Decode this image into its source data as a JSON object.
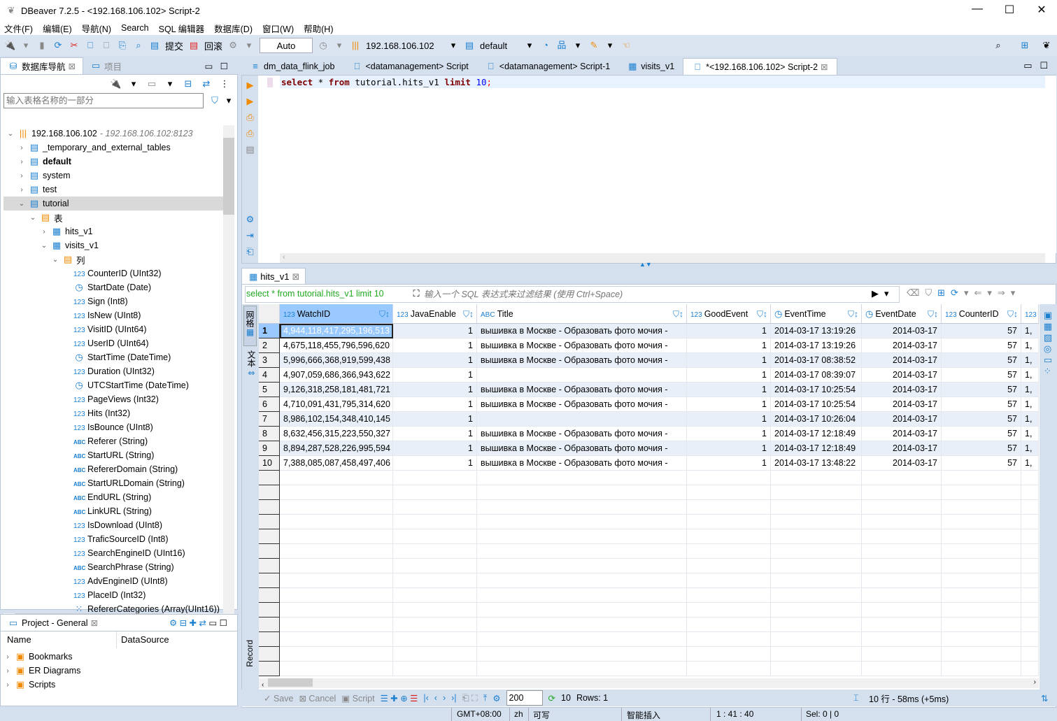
{
  "window": {
    "title": "DBeaver 7.2.5 - <192.168.106.102> Script-2"
  },
  "menu": [
    "文件(F)",
    "编辑(E)",
    "导航(N)",
    "Search",
    "SQL 编辑器",
    "数据库(D)",
    "窗口(W)",
    "帮助(H)"
  ],
  "toolbar": {
    "commit": "提交",
    "rollback": "回滚",
    "transaction_mode": "Auto",
    "connection": "192.168.106.102",
    "database": "default"
  },
  "left": {
    "nav_tab": "数据库导航",
    "project_tab": "项目",
    "filter_placeholder": "输入表格名称的一部分",
    "tree": [
      {
        "label": "192.168.106.102",
        "sub": " - 192.168.106.102:8123",
        "lvl": 0,
        "icon": "server-icon",
        "open": true
      },
      {
        "label": "_temporary_and_external_tables",
        "lvl": 1,
        "icon": "database-icon"
      },
      {
        "label": "default",
        "lvl": 1,
        "icon": "database-icon",
        "bold": true
      },
      {
        "label": "system",
        "lvl": 1,
        "icon": "database-icon"
      },
      {
        "label": "test",
        "lvl": 1,
        "icon": "database-icon"
      },
      {
        "label": "tutorial",
        "lvl": 1,
        "icon": "database-icon",
        "open": true,
        "selected": true
      },
      {
        "label": "表",
        "lvl": 2,
        "icon": "folder-icon",
        "open": true
      },
      {
        "label": "hits_v1",
        "lvl": 3,
        "icon": "table-icon"
      },
      {
        "label": "visits_v1",
        "lvl": 3,
        "icon": "table-icon",
        "open": true
      },
      {
        "label": "列",
        "lvl": 4,
        "icon": "folder-icon",
        "open": true
      },
      {
        "label": "CounterID (UInt32)",
        "lvl": 5,
        "icon": "num"
      },
      {
        "label": "StartDate (Date)",
        "lvl": 5,
        "icon": "date"
      },
      {
        "label": "Sign (Int8)",
        "lvl": 5,
        "icon": "num"
      },
      {
        "label": "IsNew (UInt8)",
        "lvl": 5,
        "icon": "num"
      },
      {
        "label": "VisitID (UInt64)",
        "lvl": 5,
        "icon": "num"
      },
      {
        "label": "UserID (UInt64)",
        "lvl": 5,
        "icon": "num"
      },
      {
        "label": "StartTime (DateTime)",
        "lvl": 5,
        "icon": "date"
      },
      {
        "label": "Duration (UInt32)",
        "lvl": 5,
        "icon": "num"
      },
      {
        "label": "UTCStartTime (DateTime)",
        "lvl": 5,
        "icon": "date"
      },
      {
        "label": "PageViews (Int32)",
        "lvl": 5,
        "icon": "num"
      },
      {
        "label": "Hits (Int32)",
        "lvl": 5,
        "icon": "num"
      },
      {
        "label": "IsBounce (UInt8)",
        "lvl": 5,
        "icon": "num"
      },
      {
        "label": "Referer (String)",
        "lvl": 5,
        "icon": "str"
      },
      {
        "label": "StartURL (String)",
        "lvl": 5,
        "icon": "str"
      },
      {
        "label": "RefererDomain (String)",
        "lvl": 5,
        "icon": "str"
      },
      {
        "label": "StartURLDomain (String)",
        "lvl": 5,
        "icon": "str"
      },
      {
        "label": "EndURL (String)",
        "lvl": 5,
        "icon": "str"
      },
      {
        "label": "LinkURL (String)",
        "lvl": 5,
        "icon": "str"
      },
      {
        "label": "IsDownload (UInt8)",
        "lvl": 5,
        "icon": "num"
      },
      {
        "label": "TraficSourceID (Int8)",
        "lvl": 5,
        "icon": "num"
      },
      {
        "label": "SearchEngineID (UInt16)",
        "lvl": 5,
        "icon": "num"
      },
      {
        "label": "SearchPhrase (String)",
        "lvl": 5,
        "icon": "str"
      },
      {
        "label": "AdvEngineID (UInt8)",
        "lvl": 5,
        "icon": "num"
      },
      {
        "label": "PlaceID (Int32)",
        "lvl": 5,
        "icon": "num"
      },
      {
        "label": "RefererCategories (Array(UInt16))",
        "lvl": 5,
        "icon": "arr"
      }
    ],
    "project": {
      "title": "Project - General",
      "col_name": "Name",
      "col_ds": "DataSource",
      "items": [
        "Bookmarks",
        "ER Diagrams",
        "Scripts"
      ]
    }
  },
  "editor": {
    "tabs": [
      "dm_data_flink_job",
      "<datamanagement> Script",
      "<datamanagement> Script-1",
      "visits_v1",
      "*<192.168.106.102> Script-2"
    ],
    "sql": {
      "kw1": "select",
      "star": " * ",
      "kw2": "from",
      "ident": " tutorial.hits_v1 ",
      "kw3": "limit",
      "num": " 10",
      "semi": ";"
    }
  },
  "results": {
    "tab": "hits_v1",
    "query": "select * from tutorial.hits_v1 limit 10",
    "filter_placeholder": "输入一个 SQL 表达式来过滤结果 (使用 Ctrl+Space)",
    "side_grid": "网格",
    "side_text": "文本",
    "side_record": "Record",
    "columns": [
      {
        "type": "123",
        "name": "WatchID"
      },
      {
        "type": "123",
        "name": "JavaEnable"
      },
      {
        "type": "ABC",
        "name": "Title"
      },
      {
        "type": "123",
        "name": "GoodEvent"
      },
      {
        "type": "clock",
        "name": "EventTime"
      },
      {
        "type": "clock",
        "name": "EventDate"
      },
      {
        "type": "123",
        "name": "CounterID"
      },
      {
        "type": "123",
        "name": ""
      }
    ],
    "rows": [
      [
        "1",
        "4,944,118,417,295,196,513",
        "1",
        "вышивка в Москве - Образовать фото мочия -",
        "1",
        "2014-03-17 13:19:26",
        "2014-03-17",
        "57",
        "1,"
      ],
      [
        "2",
        "4,675,118,455,796,596,620",
        "1",
        "вышивка в Москве - Образовать фото мочия -",
        "1",
        "2014-03-17 13:19:26",
        "2014-03-17",
        "57",
        "1,"
      ],
      [
        "3",
        "5,996,666,368,919,599,438",
        "1",
        "вышивка в Москве - Образовать фото мочия -",
        "1",
        "2014-03-17 08:38:52",
        "2014-03-17",
        "57",
        "1,"
      ],
      [
        "4",
        "4,907,059,686,366,943,622",
        "1",
        "",
        "1",
        "2014-03-17 08:39:07",
        "2014-03-17",
        "57",
        "1,"
      ],
      [
        "5",
        "9,126,318,258,181,481,721",
        "1",
        "вышивка в Москве - Образовать фото мочия -",
        "1",
        "2014-03-17 10:25:54",
        "2014-03-17",
        "57",
        "1,"
      ],
      [
        "6",
        "4,710,091,431,795,314,620",
        "1",
        "вышивка в Москве - Образовать фото мочия -",
        "1",
        "2014-03-17 10:25:54",
        "2014-03-17",
        "57",
        "1,"
      ],
      [
        "7",
        "8,986,102,154,348,410,145",
        "1",
        "",
        "1",
        "2014-03-17 10:26:04",
        "2014-03-17",
        "57",
        "1,"
      ],
      [
        "8",
        "8,632,456,315,223,550,327",
        "1",
        "вышивка в Москве - Образовать фото мочия -",
        "1",
        "2014-03-17 12:18:49",
        "2014-03-17",
        "57",
        "1,"
      ],
      [
        "9",
        "8,894,287,528,226,995,594",
        "1",
        "вышивка в Москве - Образовать фото мочия -",
        "1",
        "2014-03-17 12:18:49",
        "2014-03-17",
        "57",
        "1,"
      ],
      [
        "10",
        "7,388,085,087,458,497,406",
        "1",
        "вышивка в Москве - Образовать фото мочия -",
        "1",
        "2014-03-17 13:48:22",
        "2014-03-17",
        "57",
        "1,"
      ]
    ],
    "bottom": {
      "save": "Save",
      "cancel": "Cancel",
      "script": "Script",
      "fetch_size": "200",
      "fetched": "10",
      "rows": "Rows: 1",
      "summary": "10 行 - 58ms (+5ms)"
    }
  },
  "status": {
    "tz": "GMT+08:00",
    "lang": "zh",
    "mode": "可写",
    "insert": "智能插入",
    "pos": "1 : 41 : 40",
    "sel": "Sel: 0 | 0"
  },
  "colors": {
    "accent": "#1a7fd0",
    "selected_cell": "#99c9ff",
    "alt_row": "#e9eff8",
    "chrome": "#d5e0ef"
  }
}
